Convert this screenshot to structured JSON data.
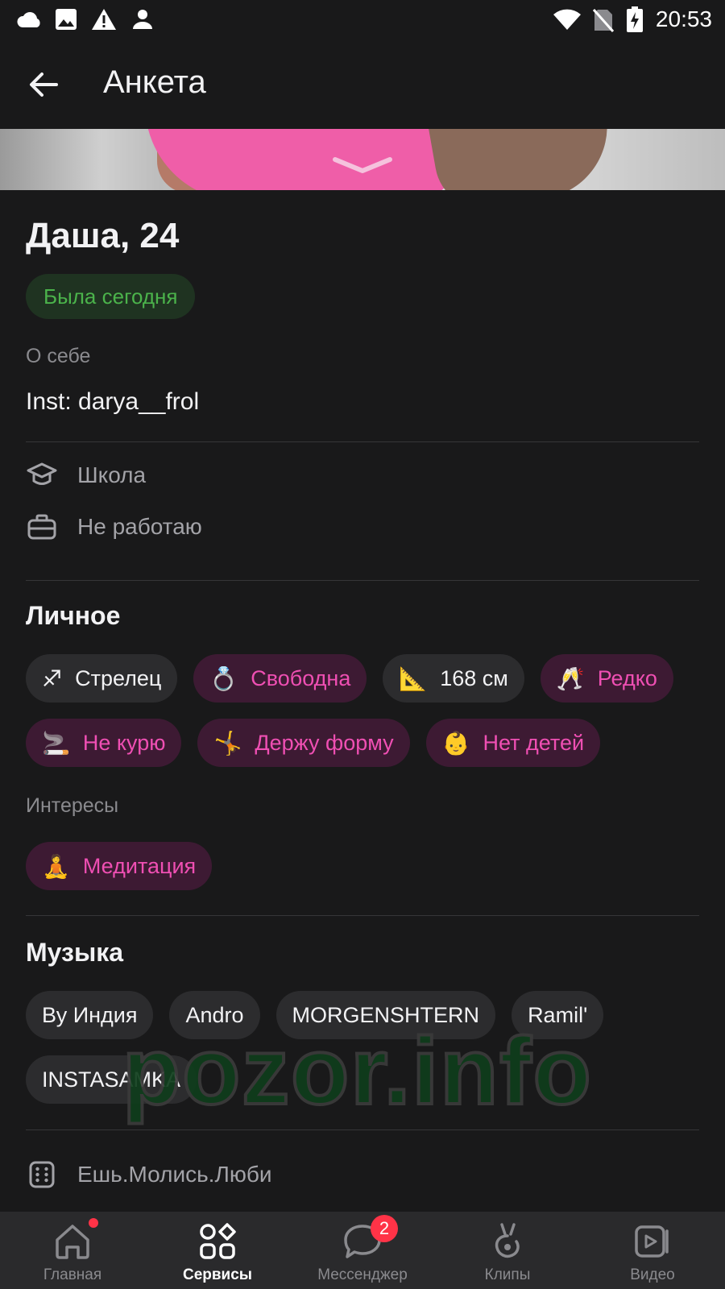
{
  "status_bar": {
    "time": "20:53",
    "left_icons": [
      "cloud-icon",
      "image-icon",
      "warning-icon",
      "person-icon"
    ],
    "right_icons": [
      "wifi-icon",
      "no-sim-icon",
      "battery-charging-icon"
    ]
  },
  "header": {
    "title": "Анкета"
  },
  "profile": {
    "name_age": "Даша, 24",
    "online_status": "Была сегодня",
    "about_label": "О себе",
    "about_text": "Inst: darya__frol",
    "education": "Школа",
    "work": "Не работаю"
  },
  "personal": {
    "title": "Личное",
    "chips": [
      {
        "emoji": "♐",
        "label": "Стрелец",
        "style": "gray"
      },
      {
        "emoji": "💍",
        "label": "Свободна",
        "style": "pink"
      },
      {
        "emoji": "📐",
        "label": "168 см",
        "style": "gray"
      },
      {
        "emoji": "🥂",
        "label": "Редко",
        "style": "pink"
      },
      {
        "emoji": "🚬",
        "label": "Не курю",
        "style": "pink"
      },
      {
        "emoji": "🤸",
        "label": "Держу форму",
        "style": "pink"
      },
      {
        "emoji": "👶",
        "label": "Нет детей",
        "style": "pink"
      }
    ]
  },
  "interests": {
    "label": "Интересы",
    "chips": [
      {
        "emoji": "🧘",
        "label": "Медитация"
      }
    ]
  },
  "music": {
    "title": "Музыка",
    "artists": [
      "Ву Индия",
      "Andro",
      "MORGENSHTERN",
      "Ramil'",
      "INSTASAMKA"
    ]
  },
  "game": {
    "text": "Ешь.Молись.Люби"
  },
  "watermark": "pozor.info",
  "nav": {
    "items": [
      {
        "label": "Главная",
        "icon": "home-icon"
      },
      {
        "label": "Сервисы",
        "icon": "services-icon"
      },
      {
        "label": "Мессенджер",
        "icon": "messenger-icon",
        "badge": "2"
      },
      {
        "label": "Клипы",
        "icon": "clips-icon"
      },
      {
        "label": "Видео",
        "icon": "video-icon"
      }
    ]
  },
  "colors": {
    "background": "#19191a",
    "accent_pink": "#ef4fb3",
    "online_green": "#4bb34b",
    "badge_red": "#ff3347"
  }
}
